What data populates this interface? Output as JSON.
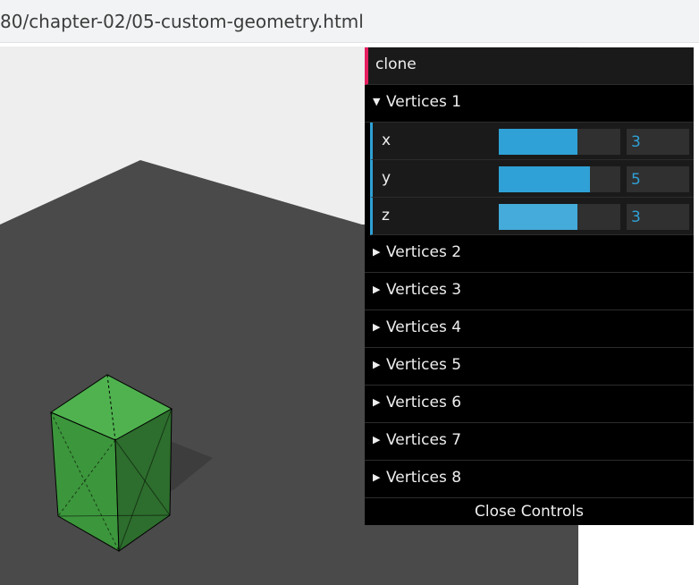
{
  "browser": {
    "url_fragment": "80/chapter-02/05-custom-geometry.html"
  },
  "scene": {
    "background_color": "#eeeeee",
    "plane_color": "#4a4a4a",
    "mesh_color": "#44aa44",
    "wireframe_color": "#000000"
  },
  "gui": {
    "clone_label": "clone",
    "folders": [
      {
        "label": "Vertices 1",
        "open": true
      },
      {
        "label": "Vertices 2",
        "open": false
      },
      {
        "label": "Vertices 3",
        "open": false
      },
      {
        "label": "Vertices 4",
        "open": false
      },
      {
        "label": "Vertices 5",
        "open": false
      },
      {
        "label": "Vertices 6",
        "open": false
      },
      {
        "label": "Vertices 7",
        "open": false
      },
      {
        "label": "Vertices 8",
        "open": false
      }
    ],
    "controllers": [
      {
        "label": "x",
        "value": "3",
        "fill_fraction": 0.65
      },
      {
        "label": "y",
        "value": "5",
        "fill_fraction": 0.75
      },
      {
        "label": "z",
        "value": "3",
        "fill_fraction": 0.65
      }
    ],
    "close_label": "Close Controls",
    "accent_color": "#2fa1d6",
    "button_accent_color": "#e61d5f"
  }
}
